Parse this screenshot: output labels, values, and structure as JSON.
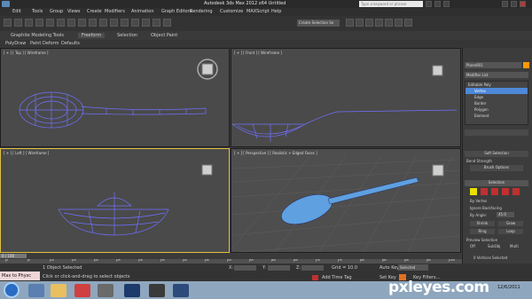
{
  "window": {
    "title": "Autodesk 3ds Max  2012 x64     Untitled",
    "search_placeholder": "Type a keyword or phrase"
  },
  "menu": [
    "Edit",
    "Tools",
    "Group",
    "Views",
    "Create",
    "Modifiers",
    "Animation",
    "Graph Editors",
    "Rendering",
    "Customize",
    "MAXScript",
    "Help"
  ],
  "toolbar": {
    "selection_set": "Create Selection Se"
  },
  "ribbon": {
    "tabs": [
      "Graphite Modeling Tools",
      "Freeform",
      "Selection",
      "Object Paint"
    ],
    "sub_tabs": [
      "PolyDraw",
      "Paint Deform",
      "Defaults"
    ]
  },
  "viewports": {
    "top": "[ + ] [ Top ] [ Wireframe ]",
    "front": "[ + ] [ Front ] [ Wireframe ]",
    "left": "[ + ] [ Left ] [ Wireframe ]",
    "perspective": "[ + ] [ Perspective ] [ Realistic + Edged Faces ]"
  },
  "command_panel": {
    "object_name": "Plane001",
    "modifier_list": "Modifier List",
    "stack": [
      "Editable Poly",
      "Vertex",
      "Edge",
      "Border",
      "Polygon",
      "Element"
    ],
    "selected_stack_index": 1,
    "soft_selection": "Soft Selection",
    "bend_strength": "Bend Strength",
    "brush_options": "Brush Options",
    "selection_rollout": "Selection",
    "by_vertex": "By Vertex",
    "ignore_backfacing": "Ignore Backfacing",
    "by_angle": "By Angle:",
    "angle_value": "45.0",
    "shrink": "Shrink",
    "grow": "Grow",
    "ring": "Ring",
    "loop": "Loop",
    "preview_selection": "Preview Selection",
    "preview_options": [
      "Off",
      "SubObj",
      "Multi"
    ],
    "vertices_selected": "0 Vertices Selected"
  },
  "timeline": {
    "frame": "0 / 100",
    "ticks": [
      "0",
      "5",
      "10",
      "15",
      "20",
      "25",
      "30",
      "35",
      "40",
      "45",
      "50",
      "55",
      "60",
      "65",
      "70",
      "75",
      "80",
      "85",
      "90",
      "95",
      "100"
    ]
  },
  "status": {
    "objects_selected": "1 Object Selected",
    "prompt": "Click or click-and-drag to select objects",
    "x_label": "X:",
    "y_label": "Y:",
    "z_label": "Z:",
    "grid": "Grid = 10.0",
    "auto_key": "Auto Key",
    "selected": "Selected",
    "set_key": "Set Key",
    "key_filters": "Key Filters...",
    "add_time_tag": "Add Time Tag",
    "maxscript": "Max to Physc"
  },
  "taskbar": {
    "time": "12/6/2011"
  },
  "watermark": "pxleyes.com",
  "colors": {
    "active_border": "#e0c040",
    "selected_stack": "#4e88d8",
    "wire": "#6a6aff"
  }
}
